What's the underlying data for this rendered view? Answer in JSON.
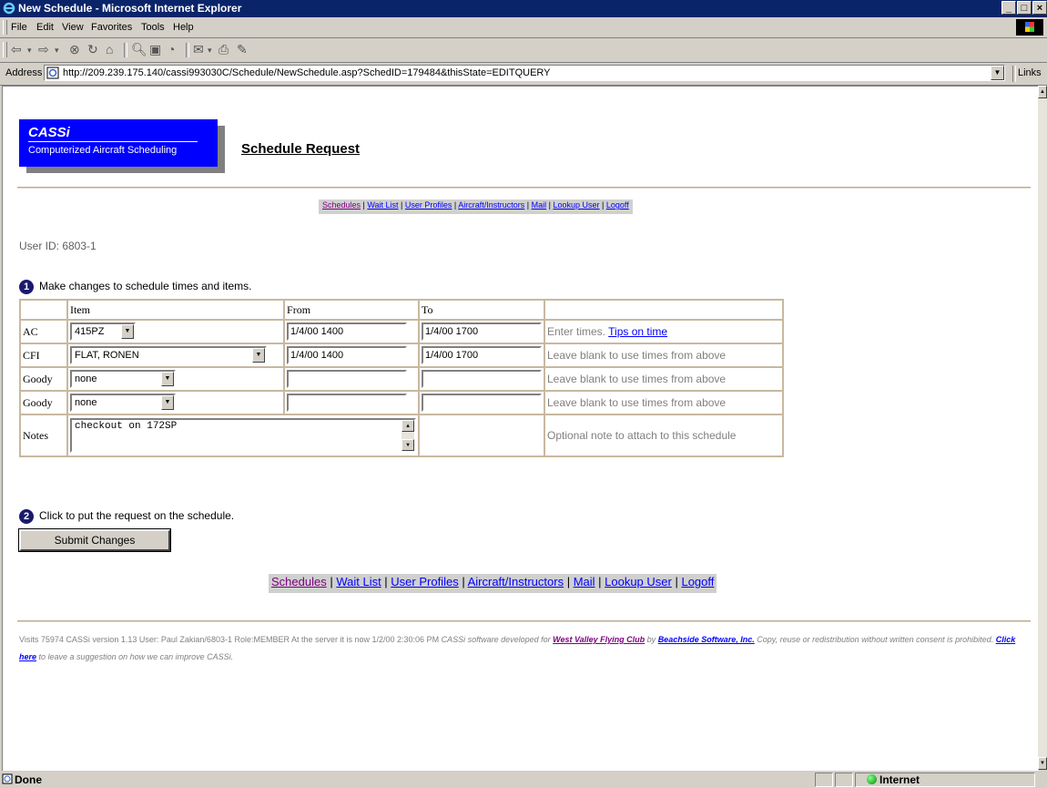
{
  "window": {
    "title": "New Schedule - Microsoft Internet Explorer",
    "buttons": [
      "_",
      "□",
      "×"
    ]
  },
  "menu": [
    "File",
    "Edit",
    "View",
    "Favorites",
    "Tools",
    "Help"
  ],
  "address": {
    "label": "Address",
    "url": "http://209.239.175.140/cassi993030C/Schedule/NewSchedule.asp?SchedID=179484&thisState=EDITQUERY",
    "links_label": "Links"
  },
  "logo": {
    "name": "CASSi",
    "subtitle": "Computerized Aircraft Scheduling"
  },
  "page_title": "Schedule Request",
  "nav": {
    "items": [
      "Schedules",
      "Wait List",
      "User Profiles",
      "Aircraft/Instructors",
      "Mail",
      "Lookup User",
      "Logoff"
    ],
    "sep": " | "
  },
  "user_id": "User ID: 6803-1",
  "step1": {
    "num": "1",
    "text": "Make changes to schedule times and items."
  },
  "step2": {
    "num": "2",
    "text": "Click to put the request on the schedule."
  },
  "table": {
    "headers": [
      "Item",
      "From",
      "To"
    ],
    "rows": [
      {
        "label": "AC",
        "item": "415PZ",
        "from": "1/4/00 1400",
        "to": "1/4/00 1700",
        "hint": "Enter times.",
        "hint_link": "Tips on time"
      },
      {
        "label": "CFI",
        "item": "FLAT, RONEN",
        "from": "1/4/00 1400",
        "to": "1/4/00 1700",
        "hint": "Leave blank to use times from above"
      },
      {
        "label": "Goody",
        "item": "none",
        "from": "",
        "to": "",
        "hint": "Leave blank to use times from above"
      },
      {
        "label": "Goody",
        "item": "none",
        "from": "",
        "to": "",
        "hint": "Leave blank to use times from above"
      }
    ],
    "notes": {
      "label": "Notes",
      "value": "checkout on 172SP",
      "hint": "Optional note to attach to this schedule"
    }
  },
  "submit_label": "Submit Changes",
  "footer": {
    "p1": "Visits 75974   CASSi version 1.13 User: Paul Zakian/6803-1 Role:MEMBER At the server it is now 1/2/00 2:30:06 PM ",
    "p2": "CASSi software developed for ",
    "club": "West Valley Flying Club",
    "by": " by ",
    "company": "Beachside Software, Inc.",
    "p3": " Copy, reuse or redistribution without written consent is prohibited. ",
    "click": "Click here",
    "p4": " to leave a suggestion on how we can improve CASSi."
  },
  "status": {
    "text": "Done",
    "zone": "Internet"
  },
  "colors": {
    "logo_blue": "#0000ff",
    "titlebar": "#0a246a",
    "link": "#0000ff",
    "visited": "#800080"
  }
}
